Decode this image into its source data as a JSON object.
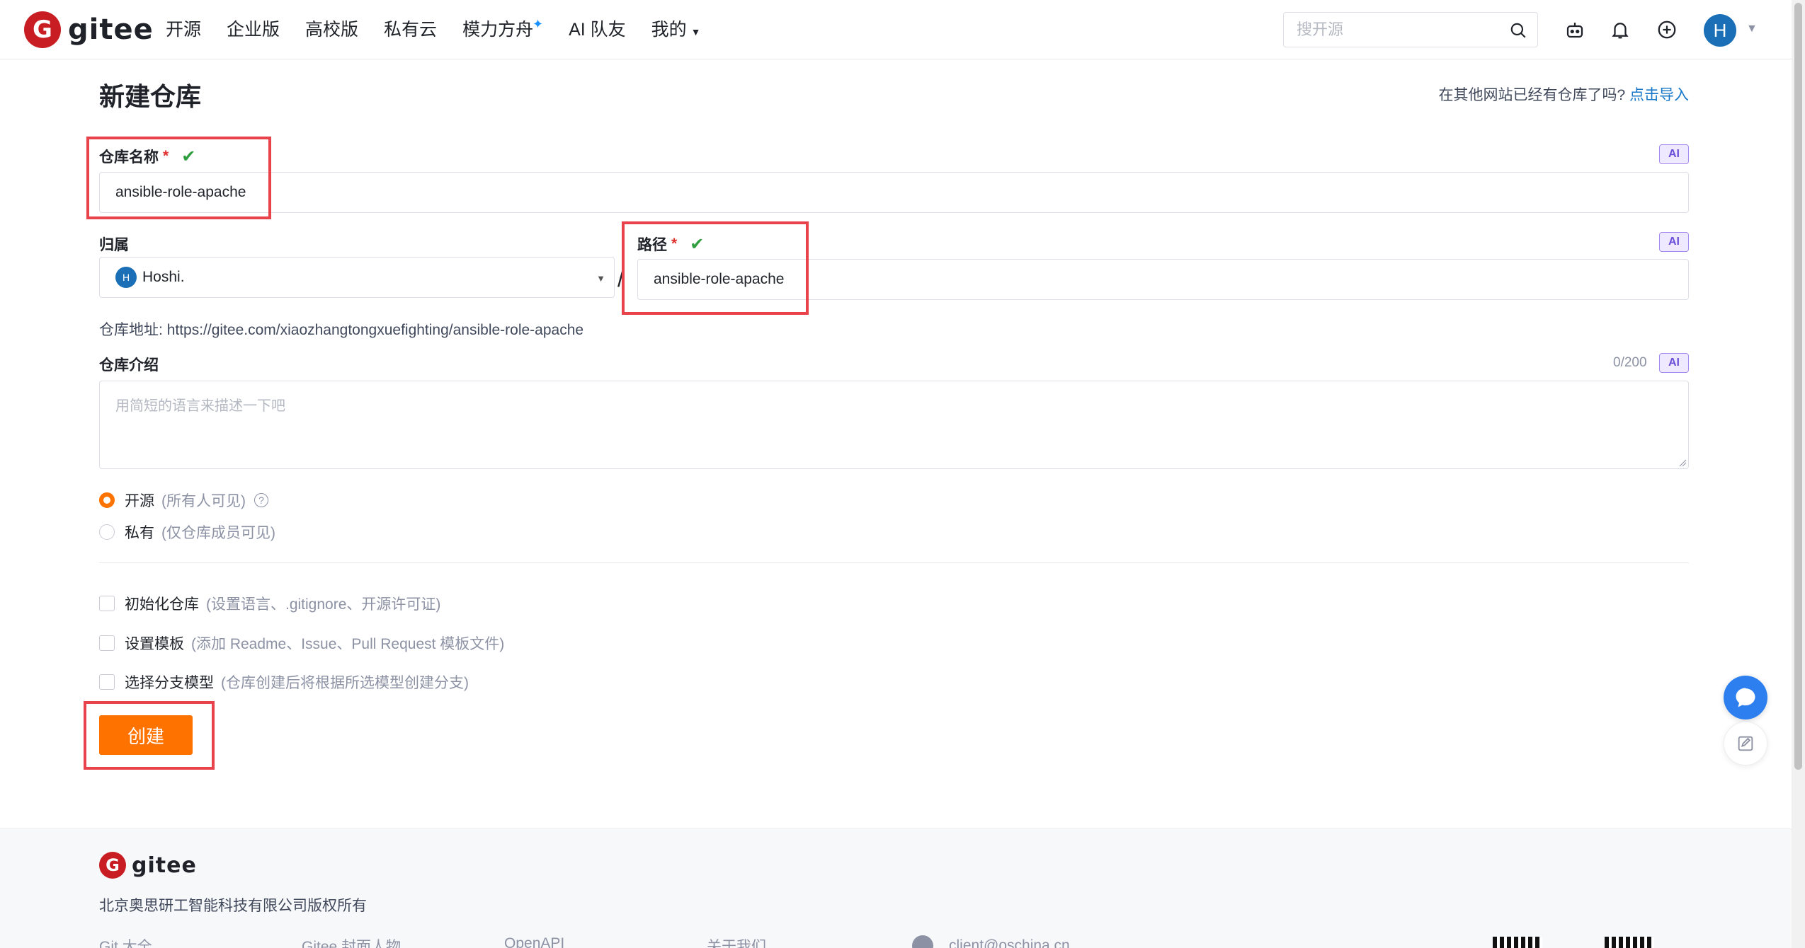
{
  "header": {
    "logo_text": "gitee",
    "logo_glyph": "G",
    "nav": [
      "开源",
      "企业版",
      "高校版",
      "私有云",
      "模力方舟",
      "AI 队友",
      "我的"
    ],
    "search_placeholder": "搜开源",
    "avatar_letter": "H"
  },
  "page": {
    "title": "新建仓库",
    "import_prompt": "在其他网站已经有仓库了吗?",
    "import_link": "点击导入"
  },
  "form": {
    "name_label": "仓库名称",
    "required_mark": "*",
    "ai_tag": "AI",
    "name_value": "ansible-role-apache",
    "owner_label": "归属",
    "owner_avatar_letter": "H",
    "owner_value": "Hoshi.",
    "path_separator": "/",
    "path_label": "路径",
    "path_value": "ansible-role-apache",
    "address_label": "仓库地址:",
    "address_value": "https://gitee.com/xiaozhangtongxuefighting/ansible-role-apache",
    "desc_label": "仓库介绍",
    "desc_count": "0/200",
    "desc_placeholder": "用简短的语言来描述一下吧",
    "visibility": [
      {
        "label": "开源",
        "hint": "(所有人可见)",
        "selected": true
      },
      {
        "label": "私有",
        "hint": "(仅仓库成员可见)",
        "selected": false
      }
    ],
    "options": [
      {
        "label": "初始化仓库",
        "hint": "(设置语言、.gitignore、开源许可证)",
        "checked": false
      },
      {
        "label": "设置模板",
        "hint": "(添加 Readme、Issue、Pull Request 模板文件)",
        "checked": false
      },
      {
        "label": "选择分支模型",
        "hint": "(仓库创建后将根据所选模型创建分支)",
        "checked": false
      }
    ],
    "create_button": "创建"
  },
  "footer": {
    "logo_text": "gitee",
    "copyright": "北京奥思研工智能科技有限公司版权所有",
    "links": [
      "Git 大全",
      "Gitee 封面人物",
      "OpenAPI",
      "关于我们"
    ],
    "email": "client@oschina.cn"
  },
  "colors": {
    "brand_red": "#c71d23",
    "accent_orange": "#fe7300",
    "link_blue": "#1677c8",
    "check_green": "#2e9e3f",
    "highlight_red": "#e8434b"
  },
  "icons": [
    "search-icon",
    "robot-icon",
    "bell-icon",
    "plus-circle-icon",
    "chevron-down-icon",
    "check-icon",
    "help-icon",
    "ai-chat-icon",
    "feedback-icon",
    "mail-icon",
    "qr-code-icon"
  ]
}
